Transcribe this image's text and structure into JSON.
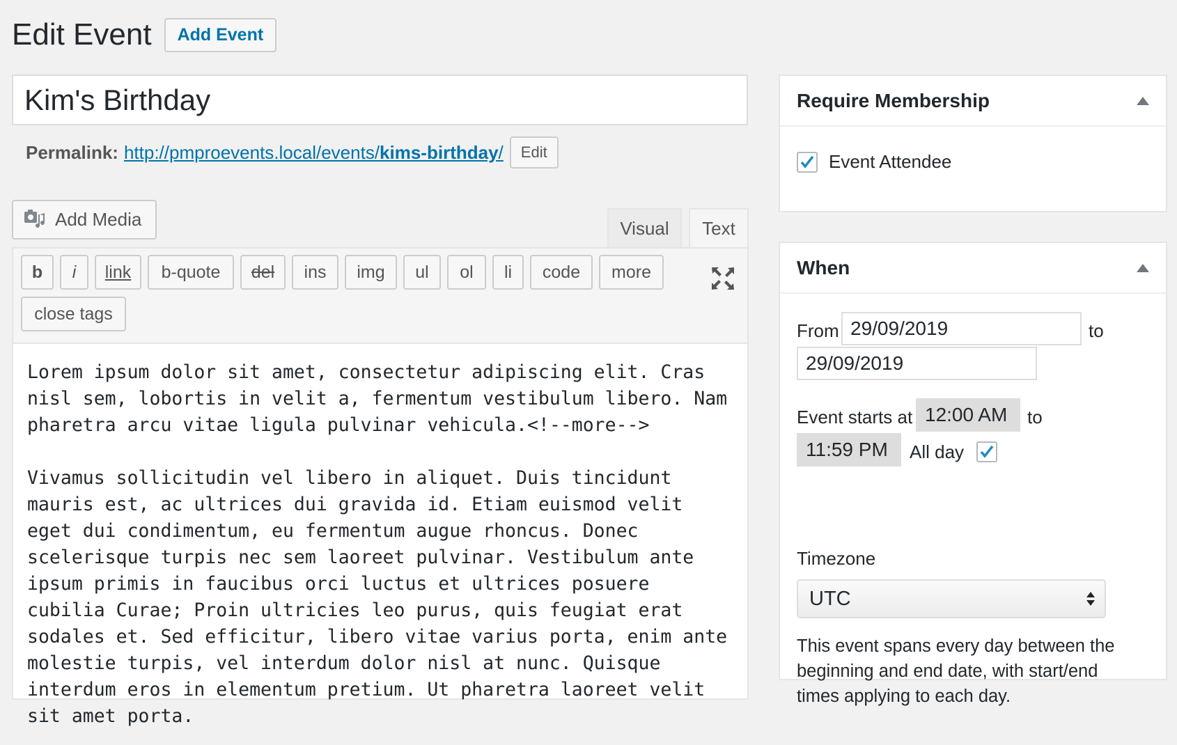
{
  "header": {
    "title": "Edit Event",
    "add_button": "Add Event"
  },
  "post": {
    "title": "Kim's Birthday",
    "permalink_label": "Permalink:",
    "permalink_base": "http://pmproevents.local/events/",
    "permalink_slug": "kims-birthday",
    "permalink_trail": "/",
    "permalink_edit": "Edit"
  },
  "editor": {
    "add_media": "Add Media",
    "tabs": {
      "visual": "Visual",
      "text": "Text"
    },
    "buttons": [
      "b",
      "i",
      "link",
      "b-quote",
      "del",
      "ins",
      "img",
      "ul",
      "ol",
      "li",
      "code",
      "more",
      "close tags"
    ],
    "content": "Lorem ipsum dolor sit amet, consectetur adipiscing elit. Cras nisl sem, lobortis in velit a, fermentum vestibulum libero. Nam pharetra arcu vitae ligula pulvinar vehicula.<!--more-->\n\nVivamus sollicitudin vel libero in aliquet. Duis tincidunt mauris est, ac ultrices dui gravida id. Etiam euismod velit eget dui condimentum, eu fermentum augue rhoncus. Donec scelerisque turpis nec sem laoreet pulvinar. Vestibulum ante ipsum primis in faucibus orci luctus et ultrices posuere cubilia Curae; Proin ultricies leo purus, quis feugiat erat sodales et. Sed efficitur, libero vitae varius porta, enim ante molestie turpis, vel interdum dolor nisl at nunc. Quisque interdum eros in elementum pretium. Ut pharetra laoreet velit sit amet porta."
  },
  "membership": {
    "title": "Require Membership",
    "levels": [
      {
        "label": "Event Attendee",
        "checked": true
      }
    ]
  },
  "when": {
    "title": "When",
    "from_label": "From",
    "from_date": "29/09/2019",
    "to_label": "to",
    "to_date": "29/09/2019",
    "starts_label": "Event starts at",
    "start_time": "12:00 AM",
    "to_label2": "to",
    "end_time": "11:59 PM",
    "all_day_label": "All day",
    "all_day_checked": true,
    "timezone_label": "Timezone",
    "timezone_value": "UTC",
    "help": "This event spans every day between the beginning and end date, with start/end times applying to each day."
  },
  "colors": {
    "link": "#0073aa",
    "check": "#1e8cbe"
  }
}
